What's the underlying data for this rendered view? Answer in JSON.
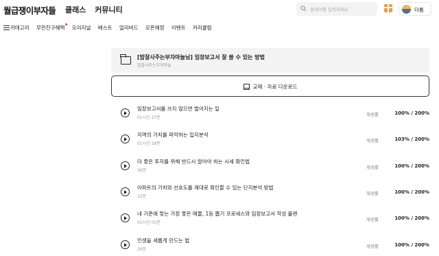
{
  "header": {
    "logo": "월급쟁이부자들",
    "nav": [
      "클래스",
      "커뮤니티"
    ],
    "search_placeholder": "검색어를 입력하세요",
    "user_name": "더룸",
    "gift_icon": "gift-icon",
    "search_icon": "search-icon"
  },
  "subnav": {
    "items": [
      "카테고리",
      "무한친구혜택",
      "오리지널",
      "베스트",
      "얼리버드",
      "오픈예정",
      "이벤트",
      "커리큘럼"
    ]
  },
  "course": {
    "title": "[밥잘사주는부자마늘님] 임장보고서 잘 쓸 수 있는 방법",
    "instructor": "밥잘사주는부자마늘"
  },
  "download": {
    "label": "교재 · 자료 다운로드"
  },
  "lessons": [
    {
      "title": "임장보고서를 쓰지 않으면 벌어지는 일",
      "duration": "01시간 27분",
      "status": "재생률",
      "progress": "100% / 200%"
    },
    {
      "title": "지역의 가치를 파악하는 입지분석",
      "duration": "01시간 28분",
      "status": "재생률",
      "progress": "103% / 200%"
    },
    {
      "title": "더 좋은 투자를 위해 반드시 알아야 하는 시세 확인법",
      "duration": "36분",
      "status": "재생률",
      "progress": "100% / 200%"
    },
    {
      "title": "아파트의 가치와 선호도를 제대로 확인할 수 있는 단지분석 방법",
      "duration": "32분",
      "status": "재생률",
      "progress": "100% / 200%"
    },
    {
      "title": "내 기준에 맞는 가장 좋은 매물, 1등 뽑기 프로세스와 임장보고서 작성 플랜",
      "duration": "01시간 05분",
      "status": "재생률",
      "progress": "100% / 200%"
    },
    {
      "title": "인생을 새롭게 만드는 법",
      "duration": "26분",
      "status": "재생률",
      "progress": "100% / 200%"
    }
  ]
}
